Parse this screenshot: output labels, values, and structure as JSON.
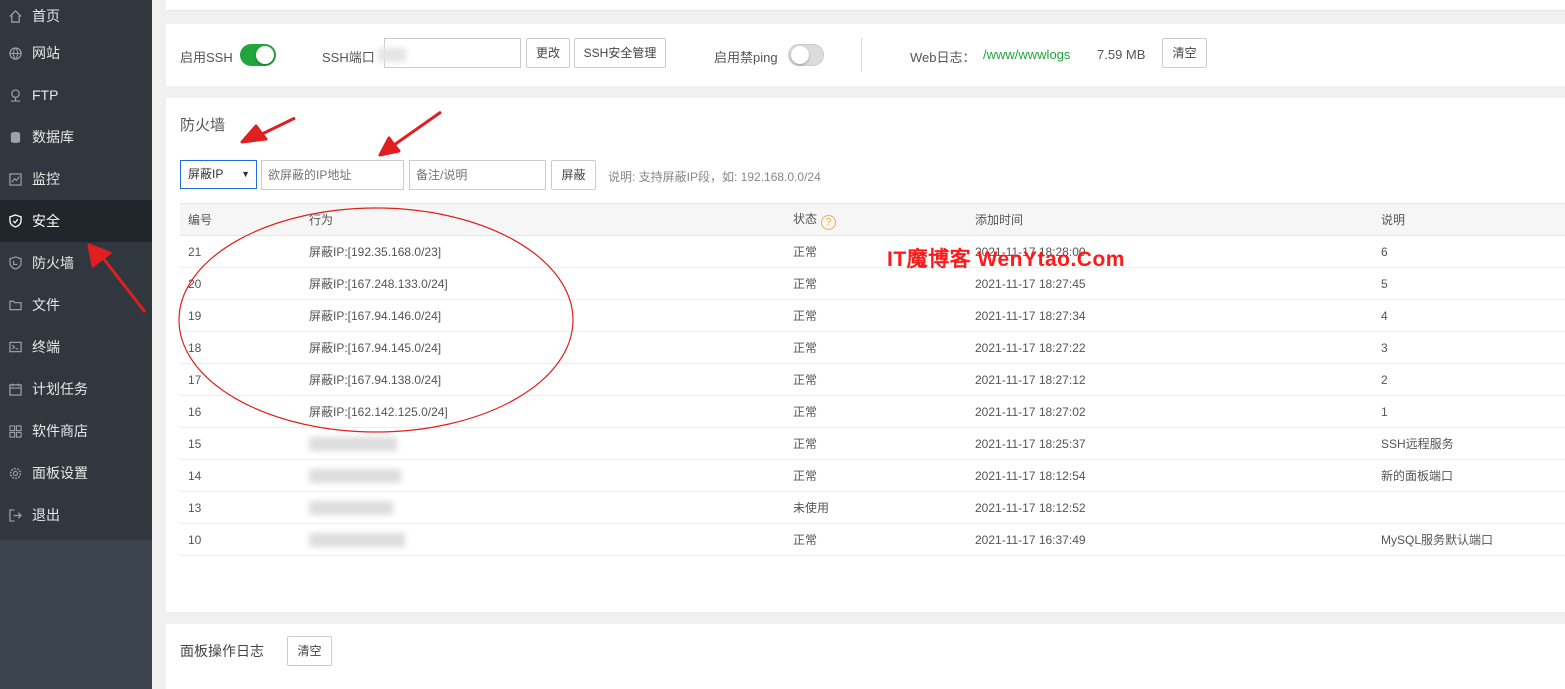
{
  "sidebar": {
    "items": [
      {
        "label": "首页",
        "icon": "home-icon"
      },
      {
        "label": "网站",
        "icon": "globe-icon"
      },
      {
        "label": "FTP",
        "icon": "ftp-icon"
      },
      {
        "label": "数据库",
        "icon": "database-icon"
      },
      {
        "label": "监控",
        "icon": "monitor-icon"
      },
      {
        "label": "安全",
        "icon": "shield-icon",
        "active": true
      },
      {
        "label": "防火墙",
        "icon": "firewall-icon"
      },
      {
        "label": "文件",
        "icon": "folder-icon"
      },
      {
        "label": "终端",
        "icon": "terminal-icon"
      },
      {
        "label": "计划任务",
        "icon": "calendar-icon"
      },
      {
        "label": "软件商店",
        "icon": "grid-icon"
      },
      {
        "label": "面板设置",
        "icon": "gear-icon"
      },
      {
        "label": "退出",
        "icon": "logout-icon"
      }
    ]
  },
  "ssh": {
    "enable_label": "启用SSH",
    "enable_on": true,
    "port_label": "SSH端口",
    "change_btn": "更改",
    "manage_btn": "SSH安全管理",
    "ping_label": "启用禁ping",
    "ping_on": false,
    "weblog_label": "Web日志：",
    "weblog_path": "/www/wwwlogs",
    "weblog_size": "7.59 MB",
    "clear_btn": "清空"
  },
  "firewall": {
    "title": "防火墙",
    "select_value": "屏蔽IP",
    "ip_placeholder": "欲屏蔽的IP地址",
    "note_placeholder": "备注/说明",
    "block_btn": "屏蔽",
    "hint": "说明: 支持屏蔽IP段，如: 192.168.0.0/24",
    "columns": [
      "编号",
      "行为",
      "状态",
      "添加时间",
      "说明"
    ],
    "rows": [
      {
        "id": "21",
        "action": "屏蔽IP:[192.35.168.0/23]",
        "status": "正常",
        "time": "2021-11-17 18:28:00",
        "note": "6"
      },
      {
        "id": "20",
        "action": "屏蔽IP:[167.248.133.0/24]",
        "status": "正常",
        "time": "2021-11-17 18:27:45",
        "note": "5"
      },
      {
        "id": "19",
        "action": "屏蔽IP:[167.94.146.0/24]",
        "status": "正常",
        "time": "2021-11-17 18:27:34",
        "note": "4"
      },
      {
        "id": "18",
        "action": "屏蔽IP:[167.94.145.0/24]",
        "status": "正常",
        "time": "2021-11-17 18:27:22",
        "note": "3"
      },
      {
        "id": "17",
        "action": "屏蔽IP:[167.94.138.0/24]",
        "status": "正常",
        "time": "2021-11-17 18:27:12",
        "note": "2"
      },
      {
        "id": "16",
        "action": "屏蔽IP:[162.142.125.0/24]",
        "status": "正常",
        "time": "2021-11-17 18:27:02",
        "note": "1"
      },
      {
        "id": "15",
        "action": "",
        "status": "正常",
        "time": "2021-11-17 18:25:37",
        "note": "SSH远程服务"
      },
      {
        "id": "14",
        "action": "",
        "status": "正常",
        "time": "2021-11-17 18:12:54",
        "note": "新的面板端口"
      },
      {
        "id": "13",
        "action": "",
        "status": "未使用",
        "time": "2021-11-17 18:12:52",
        "note": ""
      },
      {
        "id": "10",
        "action": "",
        "status": "正常",
        "time": "2021-11-17 16:37:49",
        "note": "MySQL服务默认端口"
      }
    ]
  },
  "watermark": "IT魔博客  WenYtao.Com",
  "panel_log": {
    "title": "面板操作日志",
    "clear_btn": "清空"
  },
  "colors": {
    "sidebar_bg": "#30373e",
    "active_bg": "#20262c",
    "accent_green": "#20a53a",
    "annotation_red": "#e02020"
  }
}
